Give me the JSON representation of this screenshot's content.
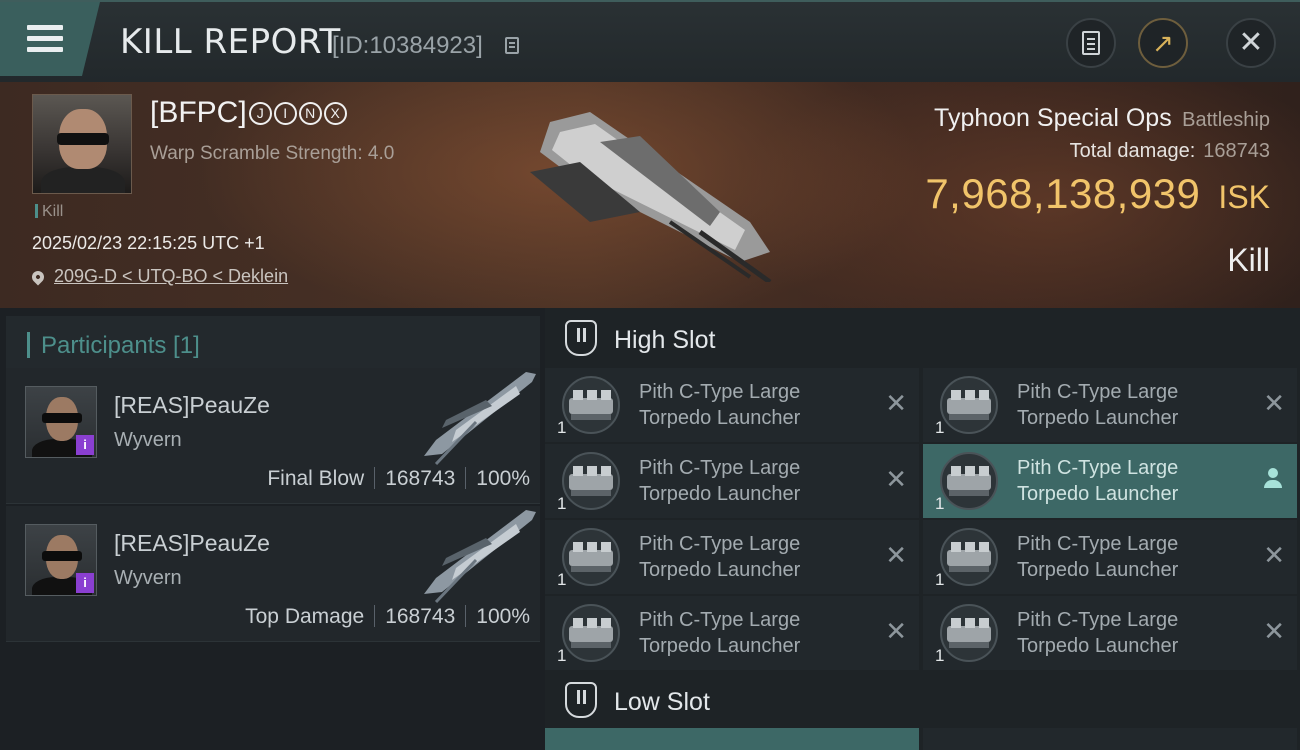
{
  "header": {
    "title": "KILL REPORT",
    "id_label": "[ID:10384923]"
  },
  "victim": {
    "name": "[BFPC]",
    "name_circled": [
      "J",
      "I",
      "N",
      "X"
    ],
    "subtitle": "Warp Scramble Strength: 4.0",
    "tag": "Kill",
    "datetime": "2025/02/23 22:15:25 UTC +1",
    "location": "209G-D < UTQ-BO < Deklein"
  },
  "ship": {
    "name": "Typhoon Special Ops",
    "class": "Battleship",
    "total_damage_label": "Total damage:",
    "total_damage": "168743",
    "isk_value": "7,968,138,939",
    "isk_unit": "ISK",
    "result": "Kill"
  },
  "participants": {
    "heading": "Participants [1]",
    "items": [
      {
        "name": "[REAS]PeauZe",
        "ship": "Wyvern",
        "role": "Final Blow",
        "damage": "168743",
        "percent": "100%"
      },
      {
        "name": "[REAS]PeauZe",
        "ship": "Wyvern",
        "role": "Top Damage",
        "damage": "168743",
        "percent": "100%"
      }
    ]
  },
  "slots": {
    "high_slot_label": "High Slot",
    "low_slot_label": "Low Slot",
    "high_modules": [
      {
        "line1": "Pith C-Type Large",
        "line2": "Torpedo Launcher",
        "qty": "1",
        "status": "destroyed"
      },
      {
        "line1": "Pith C-Type Large",
        "line2": "Torpedo Launcher",
        "qty": "1",
        "status": "destroyed"
      },
      {
        "line1": "Pith C-Type Large",
        "line2": "Torpedo Launcher",
        "qty": "1",
        "status": "destroyed"
      },
      {
        "line1": "Pith C-Type Large",
        "line2": "Torpedo Launcher",
        "qty": "1",
        "status": "dropped"
      },
      {
        "line1": "Pith C-Type Large",
        "line2": "Torpedo Launcher",
        "qty": "1",
        "status": "destroyed"
      },
      {
        "line1": "Pith C-Type Large",
        "line2": "Torpedo Launcher",
        "qty": "1",
        "status": "destroyed"
      },
      {
        "line1": "Pith C-Type Large",
        "line2": "Torpedo Launcher",
        "qty": "1",
        "status": "destroyed"
      },
      {
        "line1": "Pith C-Type Large",
        "line2": "Torpedo Launcher",
        "qty": "1",
        "status": "destroyed"
      }
    ]
  },
  "icons": {
    "menu": "hamburger-icon",
    "copy": "copy-icon",
    "doc": "document-icon",
    "share": "share-icon",
    "close": "close-icon",
    "pin": "location-pin-icon",
    "slot": "slot-shield-icon",
    "destroyed": "x-icon",
    "dropped": "person-icon"
  },
  "colors": {
    "accent": "#4d8f8b",
    "isk": "#f1c46a",
    "selected_row": "#3d6866",
    "ship_badge": "#8a3fd1"
  }
}
